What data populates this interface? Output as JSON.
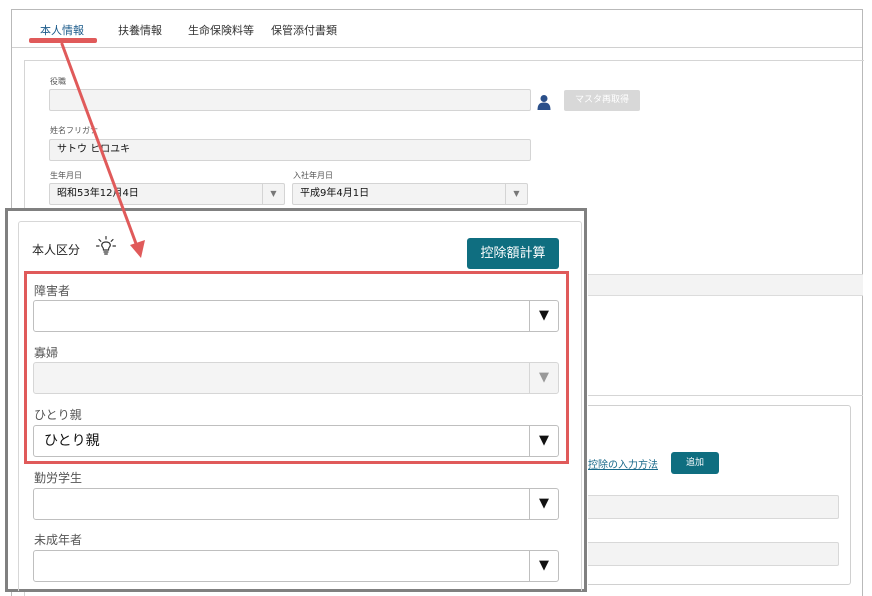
{
  "tabs": [
    {
      "label": "本人情報",
      "active": true
    },
    {
      "label": "扶養情報",
      "active": false
    },
    {
      "label": "生命保険料等",
      "active": false
    },
    {
      "label": "保管添付書類",
      "active": false
    }
  ],
  "background_form": {
    "position_label": "役職",
    "position_value": "",
    "refetch_button": "マスタ再取得",
    "kana_label": "姓名フリガナ",
    "kana_value": "サトウ ヒロユキ",
    "birth_label": "生年月日",
    "birth_value": "昭和53年12月4日",
    "joined_label": "入社年月日",
    "joined_value": "平成9年4月1日",
    "input_method_link": "控除の入力方法",
    "add_button": "追加"
  },
  "callout": {
    "title": "本人区分",
    "calc_button": "控除額計算",
    "fields": [
      {
        "label": "障害者",
        "value": "",
        "disabled": false
      },
      {
        "label": "寡婦",
        "value": "",
        "disabled": true
      },
      {
        "label": "ひとり親",
        "value": "ひとり親",
        "disabled": false
      },
      {
        "label": "勤労学生",
        "value": "",
        "disabled": false
      },
      {
        "label": "未成年者",
        "value": "",
        "disabled": false
      }
    ]
  },
  "icons": {
    "dropdown": "▼",
    "bulb": "lightbulb-icon",
    "user": "user-icon"
  },
  "colors": {
    "accent_teal": "#0f6e80",
    "highlight_red": "#e05a5a",
    "callout_border": "#808080"
  }
}
